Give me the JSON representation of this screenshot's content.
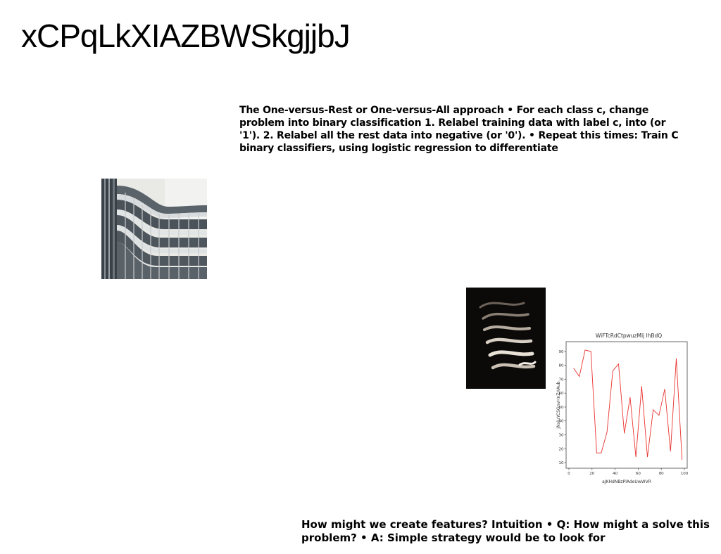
{
  "slide": {
    "title": "xCPqLkXIAZBWSkgjjbJ",
    "paragraph_top": "The One-versus-Rest or One-versus-All approach • For each class c, change problem into binary classification 1. Relabel training data with label c, into (or '1'). 2. Relabel all the rest data into negative (or '0'). • Repeat this times: Train C binary classifiers, using logistic regression to differentiate",
    "paragraph_bottom": "How might we create features? Intuition • Q: How might a solve this problem? • A: Simple strategy would be to look for"
  },
  "images": {
    "building": "curved-glass-building-photo",
    "dark": "dark-abstract-curves-photo"
  },
  "chart_data": {
    "type": "line",
    "title": "WiFTcRdCtpwuzMlj lhBdQ",
    "xlabel": "aJKHdNBzPlAdeUwWVR",
    "ylabel": "jNxluYCSGnvHnZHAub",
    "xlim": [
      0,
      100
    ],
    "ylim": [
      8,
      95
    ],
    "xticks": [
      0,
      20,
      40,
      60,
      80,
      100
    ],
    "yticks": [
      10,
      20,
      30,
      40,
      50,
      60,
      70,
      80,
      90
    ],
    "line_color": "#e8332e",
    "grid": false,
    "series": [
      {
        "x": [
          4,
          9,
          14,
          19,
          24,
          28,
          33,
          38,
          43,
          48,
          53,
          58,
          63,
          68,
          73,
          78,
          83,
          88,
          93,
          98
        ],
        "values": [
          78,
          72,
          91,
          90,
          17,
          17,
          32,
          76,
          81,
          31,
          57,
          14,
          65,
          14,
          48,
          44,
          63,
          18,
          85,
          12
        ]
      }
    ]
  }
}
